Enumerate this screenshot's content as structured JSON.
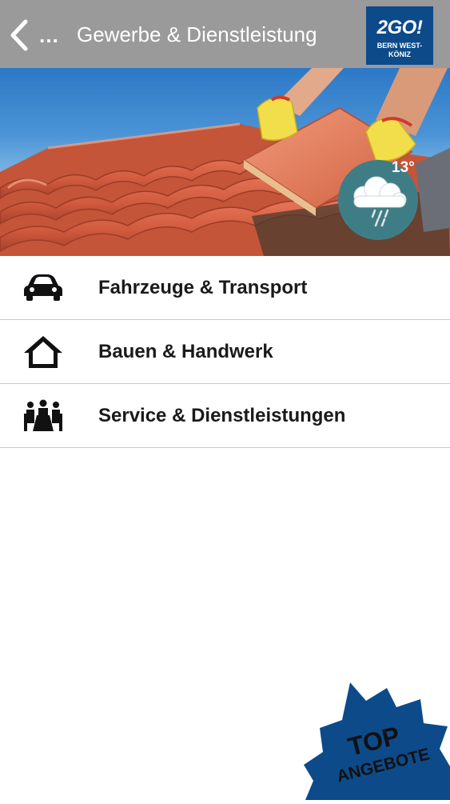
{
  "header": {
    "back_label": "…",
    "title": "Gewerbe & Dienstleistung",
    "logo_main": "2GO!",
    "logo_sub_line1": "BERN WEST-",
    "logo_sub_line2": "KÖNIZ"
  },
  "weather": {
    "temperature": "13°",
    "icon": "rain-cloud-icon"
  },
  "menu": {
    "items": [
      {
        "label": "Fahrzeuge & Transport",
        "icon": "car-icon"
      },
      {
        "label": "Bauen & Handwerk",
        "icon": "house-icon"
      },
      {
        "label": "Service & Dienstleistungen",
        "icon": "people-service-icon"
      }
    ]
  },
  "badge": {
    "line1": "TOP",
    "line2": "ANGEBOTE"
  },
  "colors": {
    "header_bg": "#9a9a9a",
    "logo_bg": "#0d4a8a",
    "badge_bg": "#0d4a8a",
    "weather_bg": "#3f7d86"
  }
}
